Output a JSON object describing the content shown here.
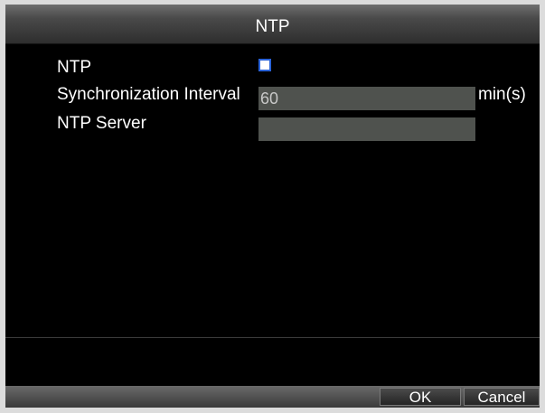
{
  "window": {
    "title": "NTP"
  },
  "form": {
    "ntp_label": "NTP",
    "ntp_enabled": false,
    "sync_interval_label": "Synchronization Interval",
    "sync_interval_value": "60",
    "sync_interval_unit": "min(s)",
    "ntp_server_label": "NTP Server",
    "ntp_server_value": ""
  },
  "buttons": {
    "ok": "OK",
    "cancel": "Cancel"
  },
  "colors": {
    "checkbox_border": "#2a63d8",
    "field_bg": "#4f524e"
  }
}
